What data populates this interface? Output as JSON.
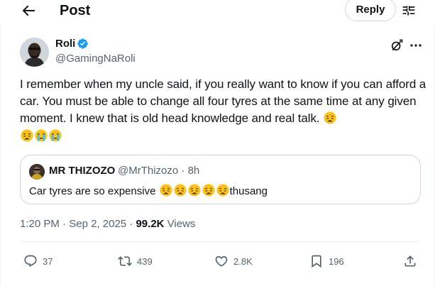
{
  "header": {
    "title": "Post",
    "reply_label": "Reply"
  },
  "icons": {
    "back": "arrow-left-icon",
    "filter": "sliders-icon",
    "verified": "verified-badge-icon",
    "grok": "grok-icon",
    "more": "more-horizontal-icon"
  },
  "post": {
    "author_name": "Roli",
    "author_handle": "@GamingNaRoli",
    "text": "I remember when my uncle said, if you really want to know if you can afford a car. You must be able to change all four tyres at the same time at any given moment. I knew that is old head knowledge and real talk.",
    "trailing_emojis": [
      "weary",
      "weary",
      "crying",
      "crying"
    ],
    "time": "1:20 PM",
    "date": "Sep 2, 2025",
    "views_count": "99.2K",
    "views_label": "Views"
  },
  "quote": {
    "author_name": "MR THIZOZO",
    "author_handle": "@MrThizozo",
    "age": "8h",
    "text_start": "Car tyres are so expensive",
    "emojis": [
      "weary",
      "weary",
      "weary",
      "weary",
      "weary"
    ],
    "text_end": "thusang"
  },
  "actions": {
    "replies": "37",
    "reposts": "439",
    "likes": "2.8K",
    "bookmarks": "196"
  },
  "colors": {
    "text": "#0f1419",
    "secondary": "#536471",
    "verified": "#1d9bf0",
    "border": "#cfd9de"
  }
}
